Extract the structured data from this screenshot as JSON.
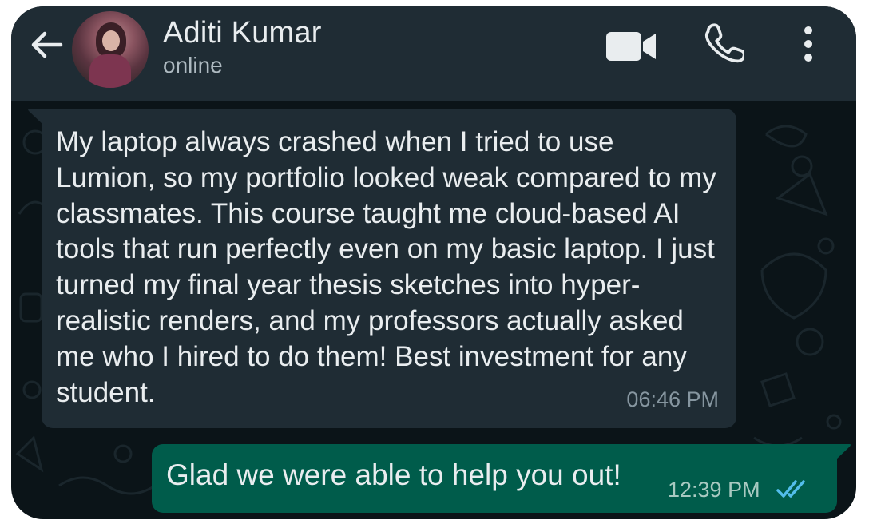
{
  "header": {
    "contact_name": "Aditi Kumar",
    "status": "online",
    "icons": {
      "back": "arrow-left-icon",
      "avatar": "contact-avatar",
      "video": "video-call-icon",
      "call": "phone-icon",
      "menu": "more-vertical-icon"
    }
  },
  "messages": [
    {
      "direction": "incoming",
      "text": "My laptop always crashed when I tried to use Lumion, so my portfolio looked weak compared to my classmates. This course taught me cloud-based AI tools that run perfectly even on my basic laptop. I just turned my final year thesis sketches into hyper-realistic renders, and my professors actually asked me who I hired to do them! Best investment for any student.",
      "time": "06:46 PM"
    },
    {
      "direction": "outgoing",
      "text": "Glad we were able to help you out!",
      "time": "12:39 PM",
      "status_icon": "double-check-read-icon"
    }
  ],
  "colors": {
    "header_bg": "#1f2c34",
    "chat_bg": "#0b1418",
    "incoming_bubble": "#1f2c34",
    "outgoing_bubble": "#005c4b",
    "primary_text": "#e9edef",
    "read_ticks": "#53bdeb"
  }
}
